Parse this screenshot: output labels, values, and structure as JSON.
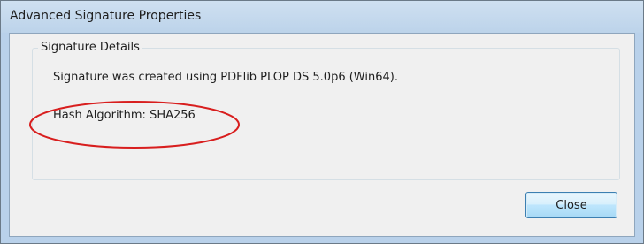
{
  "window": {
    "title": "Advanced Signature Properties"
  },
  "details": {
    "group_label": "Signature Details",
    "created_with": "Signature was created using PDFlib PLOP DS 5.0p6 (Win64).",
    "hash_algorithm": "Hash Algorithm: SHA256"
  },
  "buttons": {
    "close_label": "Close"
  },
  "colors": {
    "highlight": "#d81e1e",
    "title_bar": "#bcd3ea",
    "dialog_background": "#f0f0f0"
  }
}
